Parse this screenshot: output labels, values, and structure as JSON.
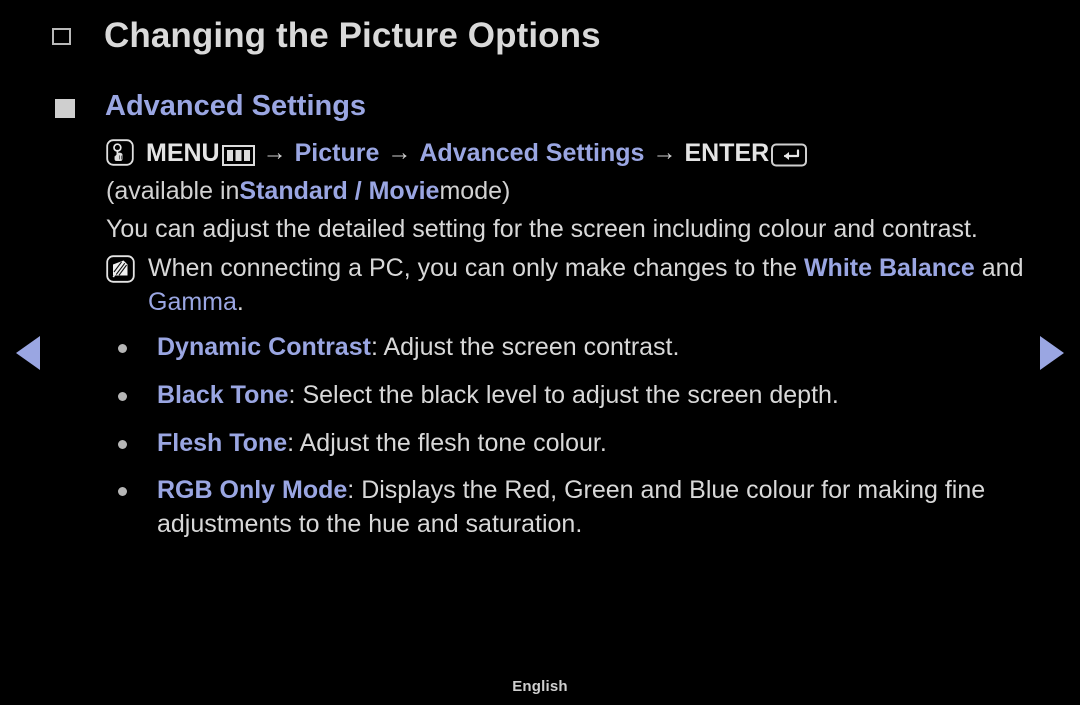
{
  "page": {
    "title": "Changing the Picture Options",
    "section_heading": "Advanced Settings",
    "footer_language": "English"
  },
  "menu_path": {
    "touch_icon": "touch-press-icon",
    "menu_label": "MENU",
    "menu_bars_icon": "menu-bars-icon",
    "arrow1": "→",
    "picture_label": "Picture",
    "arrow2": "→",
    "advanced_label": "Advanced Settings",
    "arrow3": "→",
    "enter_label": "ENTER",
    "enter_icon": "enter-return-icon"
  },
  "availability": {
    "prefix": "(available in ",
    "modes": "Standard / Movie",
    "suffix": " mode)"
  },
  "description": "You can adjust the detailed setting for the screen including colour and contrast.",
  "note": {
    "icon": "note-pencil-icon",
    "part1": "When connecting a PC, you can only make changes to the ",
    "highlight1": "White Balance",
    "part2": " and ",
    "highlight2": "Gamma",
    "part3": "."
  },
  "options": [
    {
      "name": "Dynamic Contrast",
      "separator": ": ",
      "description": "Adjust the screen contrast."
    },
    {
      "name": "Black Tone",
      "separator": ": ",
      "description": "Select the black level to adjust the screen depth."
    },
    {
      "name": "Flesh Tone",
      "separator": ": ",
      "description": "Adjust the flesh tone colour."
    },
    {
      "name": "RGB Only Mode",
      "separator": ": ",
      "description": "Displays the Red, Green and Blue colour for making fine adjustments to the hue and saturation."
    }
  ],
  "navigation": {
    "prev_icon": "previous-page-arrow",
    "next_icon": "next-page-arrow"
  },
  "colors": {
    "background": "#000000",
    "accent_blue": "#9aa6e2",
    "body_text": "#d8d8d8",
    "title_text": "#d9d9d9"
  }
}
